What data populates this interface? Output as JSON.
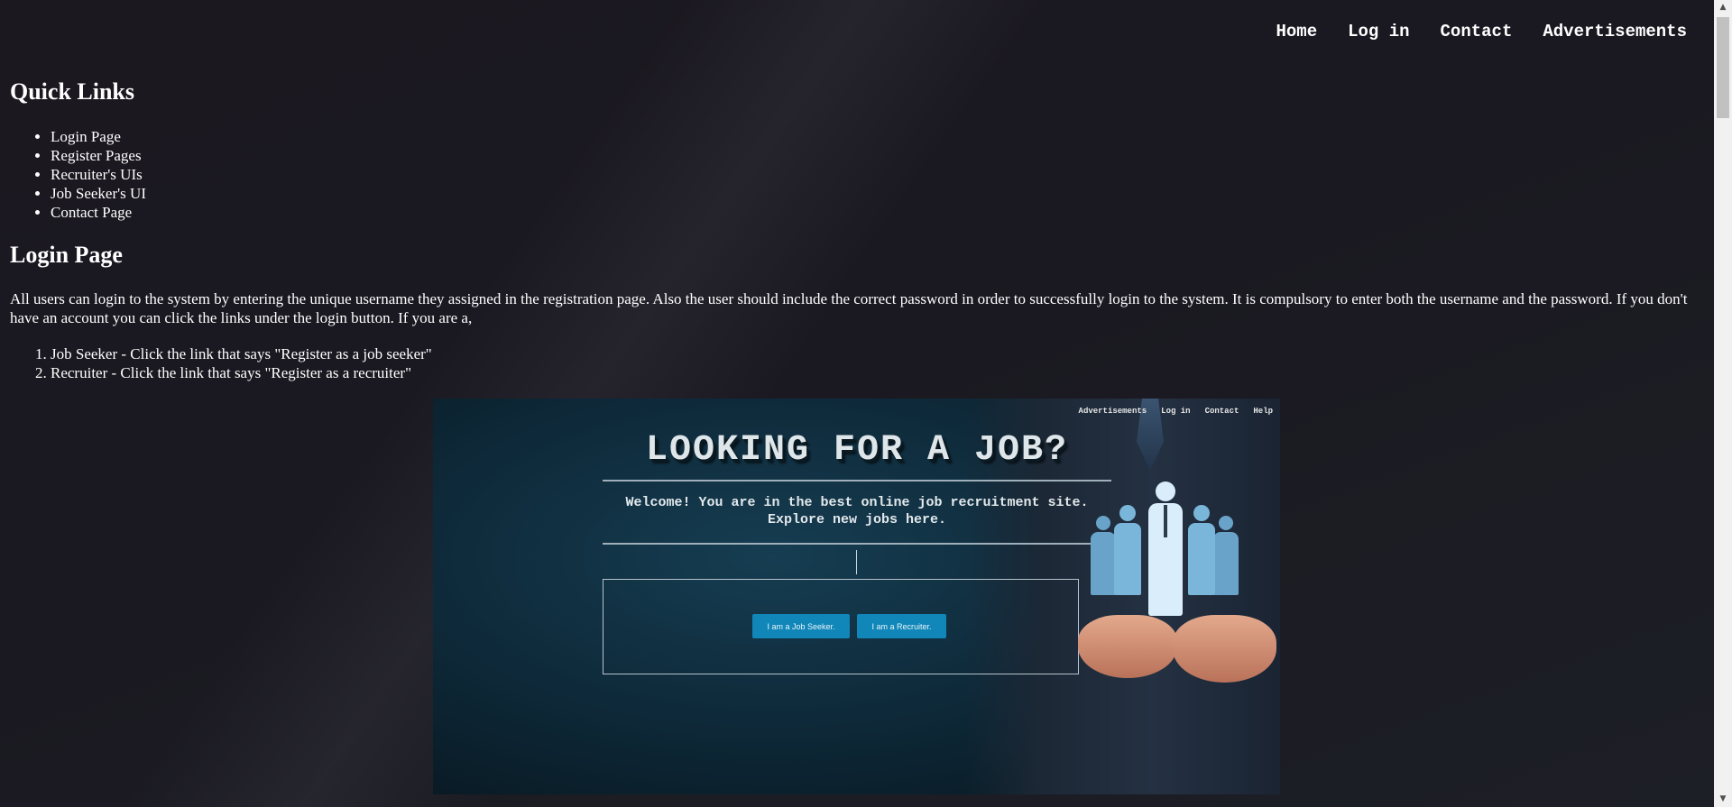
{
  "nav": {
    "items": [
      "Home",
      "Log in",
      "Contact",
      "Advertisements"
    ]
  },
  "quick_links": {
    "title": "Quick Links",
    "items": [
      "Login Page",
      "Register Pages",
      "Recruiter's UIs",
      "Job Seeker's UI",
      "Contact Page"
    ]
  },
  "login_section": {
    "title": "Login Page",
    "paragraph": "All users can login to the system by entering the unique username they assigned in the registration page. Also the user should include the correct password in order to successfully login to the system. It is compulsory to enter both the username and the password. If you don't have an account you can click the links under the login button. If you are a,",
    "steps": [
      "Job Seeker - Click the link that says \"Register as a job seeker\"",
      "Recruiter - Click the link that says \"Register as a recruiter\""
    ]
  },
  "screenshot": {
    "nav": [
      "Advertisements",
      "Log in",
      "Contact",
      "Help"
    ],
    "title": "LOOKING FOR A JOB?",
    "welcome_line1": "Welcome! You are in the best online job recruitment site.",
    "welcome_line2": "Explore new jobs here.",
    "btn_seeker": "I am a Job Seeker.",
    "btn_recruiter": "I am a Recruiter."
  },
  "scrollbar": {
    "up_icon": "triangle-up-icon",
    "down_icon": "triangle-down-icon",
    "up_glyph": "▲",
    "down_glyph": "▼"
  }
}
